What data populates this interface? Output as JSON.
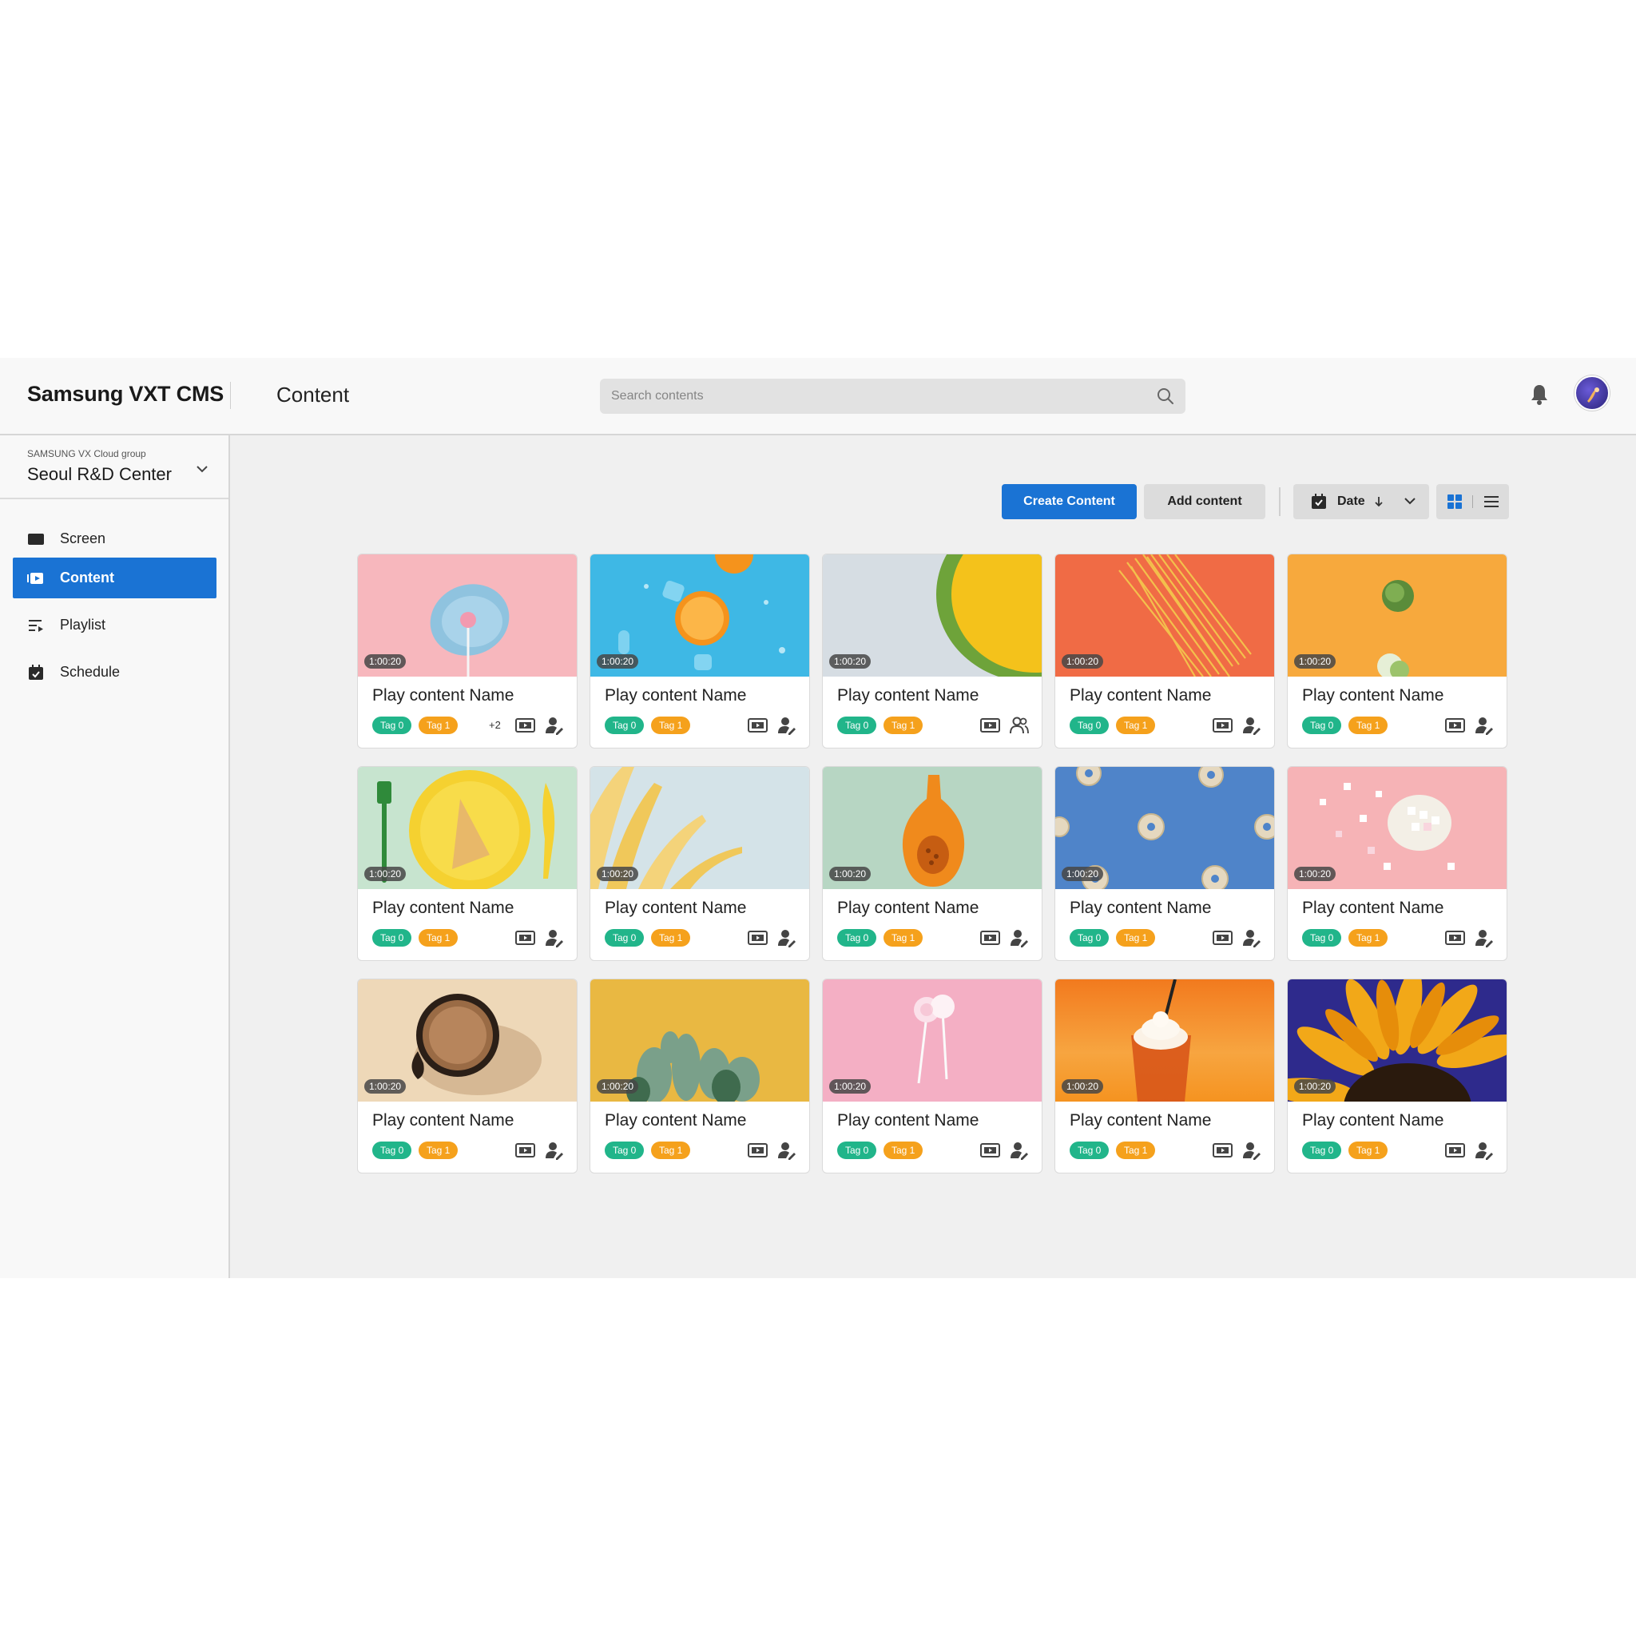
{
  "header": {
    "brand": "Samsung VXT CMS",
    "page_title": "Content",
    "search_placeholder": "Search contents",
    "icons": [
      "search-icon",
      "bell-icon",
      "avatar"
    ]
  },
  "sidebar": {
    "group_label": "SAMSUNG VX Cloud group",
    "group_name": "Seoul R&D Center",
    "items": [
      {
        "label": "Screen",
        "icon": "screen-icon",
        "active": false
      },
      {
        "label": "Content",
        "icon": "content-icon",
        "active": true
      },
      {
        "label": "Playlist",
        "icon": "playlist-icon",
        "active": false
      },
      {
        "label": "Schedule",
        "icon": "calendar-icon",
        "active": false
      }
    ]
  },
  "toolbar": {
    "create_label": "Create Content",
    "add_label": "Add content",
    "sort_label": "Date",
    "view_mode": "grid"
  },
  "colors": {
    "accent": "#1a73d4",
    "tag0": "#21b58a",
    "tag1": "#f5a11c"
  },
  "cards": [
    {
      "title": "Play content Name",
      "duration": "1:00:20",
      "tags": [
        "Tag 0",
        "Tag 1"
      ],
      "more": "+2",
      "thumb": "pink-lollipop-plate",
      "user_icon": "user-edit-icon"
    },
    {
      "title": "Play content Name",
      "duration": "1:00:20",
      "tags": [
        "Tag 0",
        "Tag 1"
      ],
      "more": "",
      "thumb": "oranges-ice-blue",
      "user_icon": "user-edit-icon"
    },
    {
      "title": "Play content Name",
      "duration": "1:00:20",
      "tags": [
        "Tag 0",
        "Tag 1"
      ],
      "more": "",
      "thumb": "melon-half-grey",
      "user_icon": "users-icon"
    },
    {
      "title": "Play content Name",
      "duration": "1:00:20",
      "tags": [
        "Tag 0",
        "Tag 1"
      ],
      "more": "",
      "thumb": "spaghetti-orange",
      "user_icon": "user-edit-icon"
    },
    {
      "title": "Play content Name",
      "duration": "1:00:20",
      "tags": [
        "Tag 0",
        "Tag 1"
      ],
      "more": "",
      "thumb": "sprouts-orange",
      "user_icon": "user-edit-icon"
    },
    {
      "title": "Play content Name",
      "duration": "1:00:20",
      "tags": [
        "Tag 0",
        "Tag 1"
      ],
      "more": "",
      "thumb": "waffle-yellow-plate",
      "user_icon": "user-edit-icon"
    },
    {
      "title": "Play content Name",
      "duration": "1:00:20",
      "tags": [
        "Tag 0",
        "Tag 1"
      ],
      "more": "",
      "thumb": "yellow-leaves",
      "user_icon": "user-edit-icon"
    },
    {
      "title": "Play content Name",
      "duration": "1:00:20",
      "tags": [
        "Tag 0",
        "Tag 1"
      ],
      "more": "",
      "thumb": "butternut-squash",
      "user_icon": "user-edit-icon"
    },
    {
      "title": "Play content Name",
      "duration": "1:00:20",
      "tags": [
        "Tag 0",
        "Tag 1"
      ],
      "more": "",
      "thumb": "donuts-blue",
      "user_icon": "user-edit-icon"
    },
    {
      "title": "Play content Name",
      "duration": "1:00:20",
      "tags": [
        "Tag 0",
        "Tag 1"
      ],
      "more": "",
      "thumb": "marshmallows-pink",
      "user_icon": "user-edit-icon"
    },
    {
      "title": "Play content Name",
      "duration": "1:00:20",
      "tags": [
        "Tag 0",
        "Tag 1"
      ],
      "more": "",
      "thumb": "coffee-cup-beige",
      "user_icon": "user-edit-icon"
    },
    {
      "title": "Play content Name",
      "duration": "1:00:20",
      "tags": [
        "Tag 0",
        "Tag 1"
      ],
      "more": "",
      "thumb": "cactus-yellow",
      "user_icon": "user-edit-icon"
    },
    {
      "title": "Play content Name",
      "duration": "1:00:20",
      "tags": [
        "Tag 0",
        "Tag 1"
      ],
      "more": "",
      "thumb": "lollipops-pink",
      "user_icon": "user-edit-icon"
    },
    {
      "title": "Play content Name",
      "duration": "1:00:20",
      "tags": [
        "Tag 0",
        "Tag 1"
      ],
      "more": "",
      "thumb": "iced-drink-orange",
      "user_icon": "user-edit-icon"
    },
    {
      "title": "Play content Name",
      "duration": "1:00:20",
      "tags": [
        "Tag 0",
        "Tag 1"
      ],
      "more": "",
      "thumb": "sunflower-purple",
      "user_icon": "user-edit-icon"
    }
  ]
}
